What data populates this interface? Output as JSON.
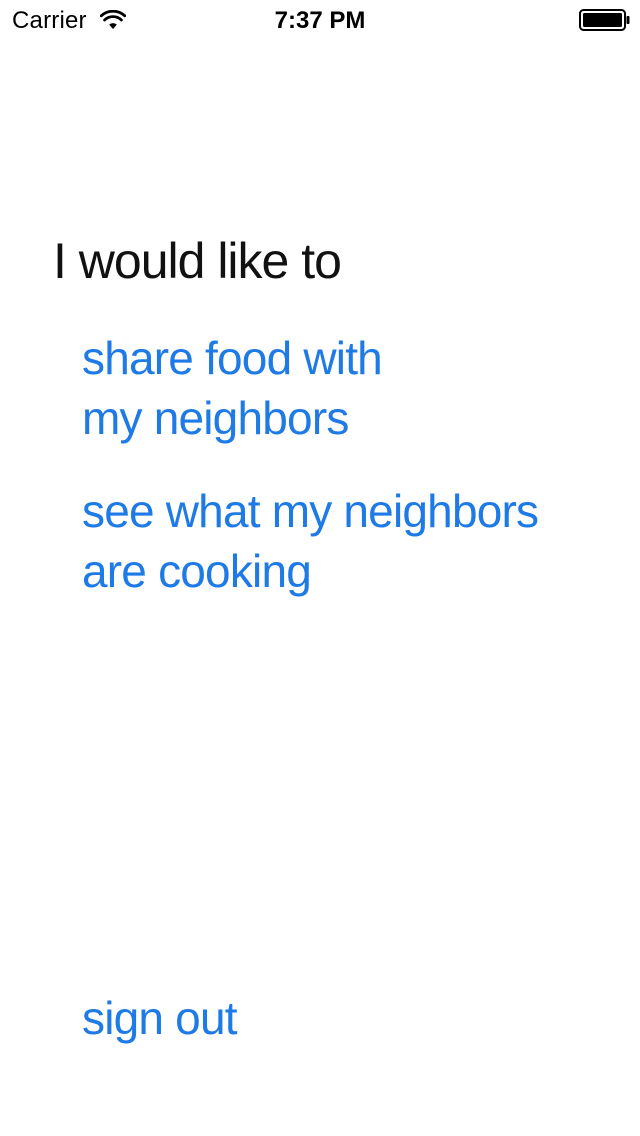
{
  "status_bar": {
    "carrier": "Carrier",
    "time": "7:37 PM",
    "wifi_icon": "wifi-icon",
    "battery_icon": "battery-full-icon"
  },
  "main": {
    "prompt": "I would like to",
    "options": [
      {
        "line1": "share food with",
        "line2": "my neighbors"
      },
      {
        "line1": "see what my neighbors",
        "line2": "are cooking"
      }
    ],
    "sign_out": "sign out"
  },
  "colors": {
    "link": "#1d7ae6",
    "text": "#111111",
    "background": "#ffffff"
  }
}
